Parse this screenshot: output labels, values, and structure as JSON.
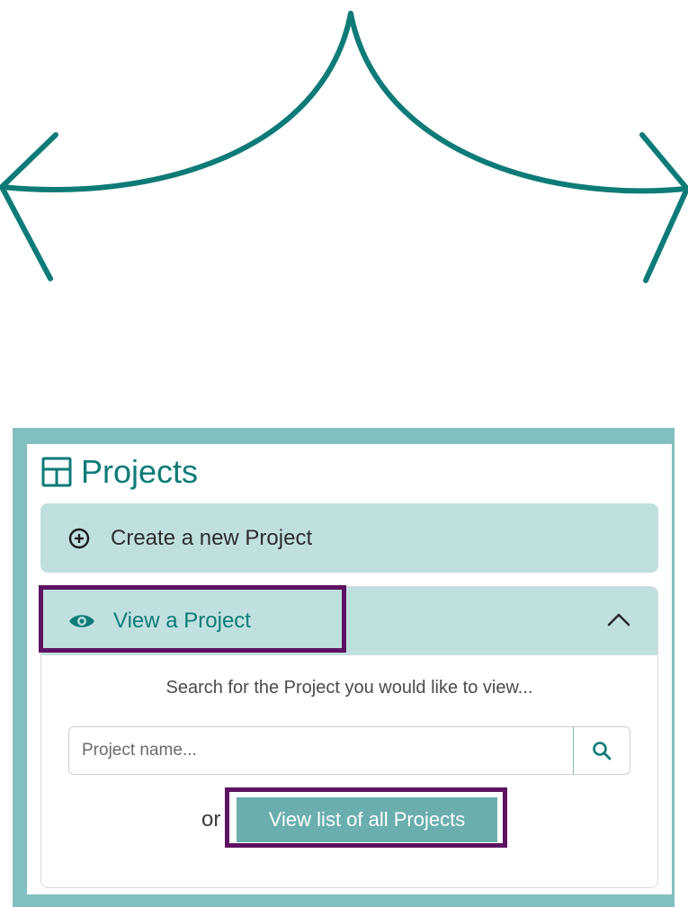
{
  "colors": {
    "teal": "#0d7b78",
    "frame": "#82bfbf",
    "header_bg": "#c0e0df",
    "button_bg": "#6aaeae",
    "highlight": "#5d1361"
  },
  "header": {
    "icon": "grid-icon",
    "title": "Projects"
  },
  "create_panel": {
    "icon": "plus-circle-icon",
    "label": "Create a new Project"
  },
  "view_panel": {
    "icon": "eye-icon",
    "label": "View a Project",
    "toggle_icon": "chevron-up-icon",
    "hint": "Search for the Project you would like to view...",
    "search": {
      "placeholder": "Project name...",
      "value": "",
      "button_icon": "search-icon"
    },
    "or_text": "or",
    "list_button_label": "View list of all Projects"
  }
}
